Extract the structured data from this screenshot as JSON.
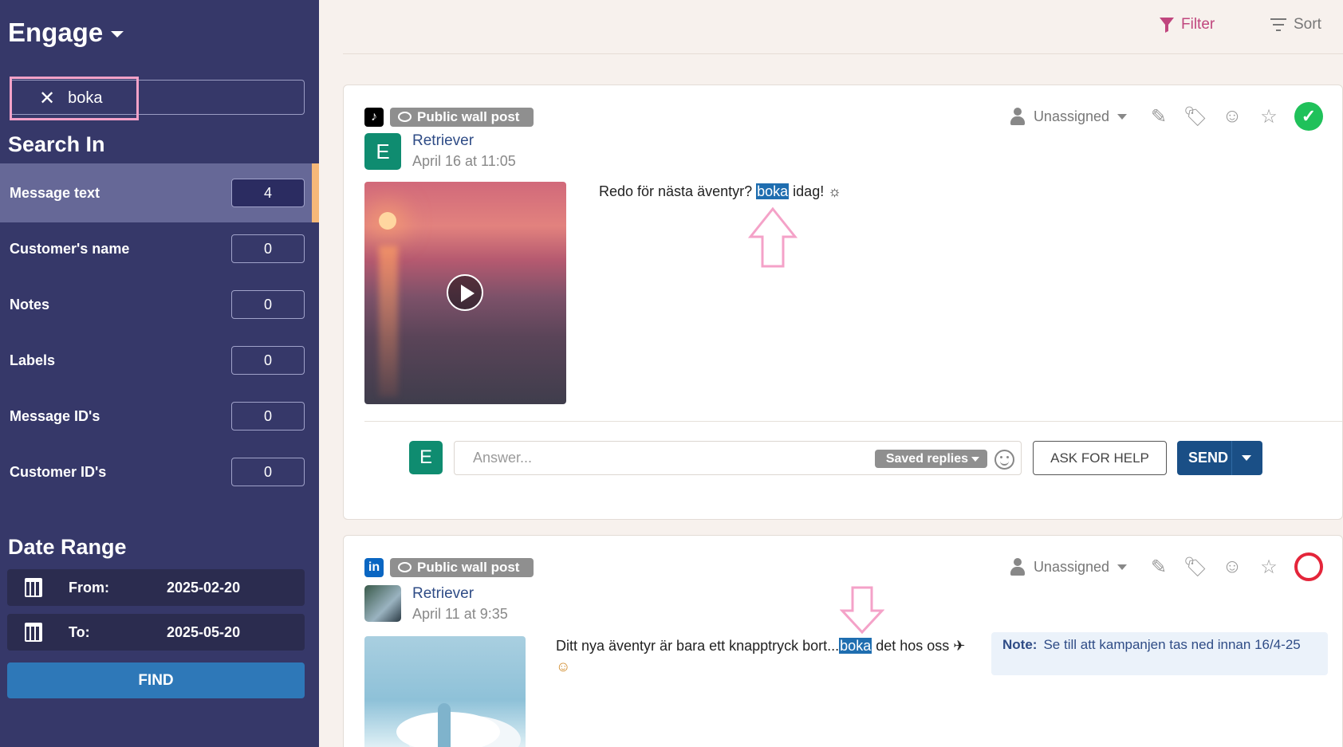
{
  "sidebar": {
    "brand": "Engage",
    "search": {
      "query": "boka"
    },
    "search_in_title": "Search In",
    "search_in": [
      {
        "label": "Message text",
        "count": "4"
      },
      {
        "label": "Customer's name",
        "count": "0"
      },
      {
        "label": "Notes",
        "count": "0"
      },
      {
        "label": "Labels",
        "count": "0"
      },
      {
        "label": "Message ID's",
        "count": "0"
      },
      {
        "label": "Customer ID's",
        "count": "0"
      }
    ],
    "date_range_title": "Date Range",
    "from_label": "From:",
    "from_value": "2025-02-20",
    "to_label": "To:",
    "to_value": "2025-05-20",
    "find_label": "FIND"
  },
  "toolbar": {
    "filter_label": "Filter",
    "sort_label": "Sort"
  },
  "posts": [
    {
      "network": "tiktok",
      "badge": "Public wall post",
      "avatar_letter": "E",
      "author": "Retriever",
      "timestamp": "April 16 at 11:05",
      "assignee": "Unassigned",
      "status": "done",
      "text_before": "Redo för nästa äventyr? ",
      "highlight": "boka",
      "text_after": " idag! ☼",
      "reply": {
        "avatar_letter": "E",
        "placeholder": "Answer...",
        "saved_replies_label": "Saved replies",
        "ask_for_help_label": "ASK FOR HELP",
        "send_label": "SEND"
      }
    },
    {
      "network": "linkedin",
      "network_icon_label": "in",
      "badge": "Public wall post",
      "author": "Retriever",
      "timestamp": "April 11 at 9:35",
      "assignee": "Unassigned",
      "status": "open",
      "text_before": "Ditt nya äventyr är bara ett knapptryck bort...",
      "highlight": "boka",
      "text_after": " det hos oss ✈",
      "text_line2": "☺",
      "note_label": "Note:",
      "note_text": "Se till att kampanjen tas ned innan 16/4-25"
    }
  ],
  "colors": {
    "sidebar_bg": "#363869",
    "active_row": "#666897",
    "accent": "#f7b878",
    "highlight": "#1f6eb0",
    "done": "#20c15a",
    "open": "#e4253a",
    "send": "#1a4f86",
    "annotation": "#f4a2c8"
  }
}
